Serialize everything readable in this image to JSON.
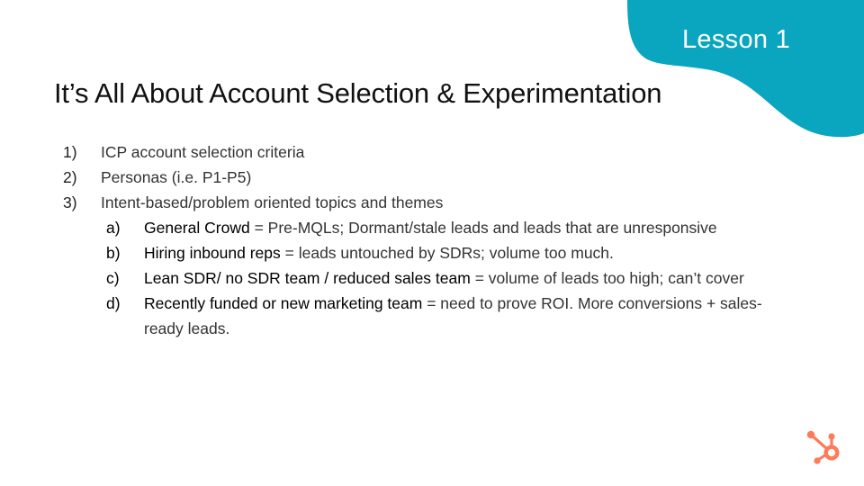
{
  "slide": {
    "badge": "Lesson 1",
    "title": "It’s All About Account Selection & Experimentation",
    "accent_color": "#0aa5be",
    "logo_color": "#ff7a59",
    "logo": "hubspot-sprocket-icon"
  },
  "list": {
    "items": [
      {
        "num": "1)",
        "text": "ICP account selection criteria"
      },
      {
        "num": "2)",
        "text": "Personas (i.e. P1-P5)"
      },
      {
        "num": "3)",
        "text": "Intent-based/problem oriented topics and themes"
      }
    ],
    "subitems": [
      {
        "label": "a)",
        "key": "General Crowd",
        "rest": " = Pre-MQLs; Dormant/stale leads and leads that are unresponsive"
      },
      {
        "label": "b)",
        "key": "Hiring inbound reps",
        "rest": " = leads untouched by SDRs; volume too much."
      },
      {
        "label": "c)",
        "key": "Lean SDR/ no SDR team / reduced sales team",
        "rest": " = volume of leads too high; can’t cover"
      },
      {
        "label": "d)",
        "key": "Recently funded or new marketing team",
        "rest": " = need to prove ROI. More conversions + sales-ready leads."
      }
    ]
  }
}
